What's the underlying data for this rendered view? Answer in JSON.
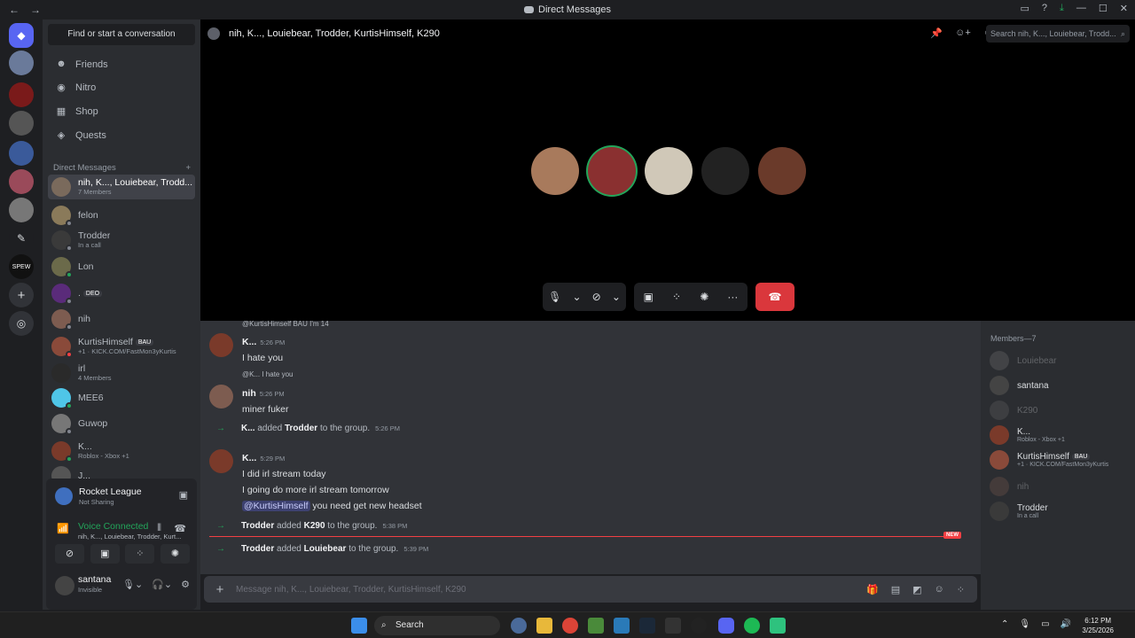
{
  "window": {
    "title": "Direct Messages",
    "back": "←",
    "forward": "→"
  },
  "titlebar_icons": [
    "inbox-icon",
    "help-icon",
    "download-icon",
    "minimize-icon",
    "maximize-icon",
    "close-icon"
  ],
  "sidebar": {
    "search_button": "Find or start a conversation",
    "nav": [
      {
        "label": "Friends",
        "icon": "friends-icon"
      },
      {
        "label": "Nitro",
        "icon": "nitro-icon"
      },
      {
        "label": "Shop",
        "icon": "shop-icon"
      },
      {
        "label": "Quests",
        "icon": "quests-icon"
      }
    ],
    "dm_header": "Direct Messages",
    "dm_add": "+",
    "dms": [
      {
        "name": "nih, K..., Louiebear, Trodd...",
        "sub": "7 Members",
        "color": "#7a6a5c",
        "status": ""
      },
      {
        "name": "felon",
        "sub": "",
        "color": "#8a7a5a",
        "status": "off"
      },
      {
        "name": "Trodder",
        "sub": "In a call",
        "color": "#3a3a3a",
        "status": "off"
      },
      {
        "name": "Lon",
        "sub": "",
        "color": "#6b6a4a",
        "status": "on"
      },
      {
        "name": ".",
        "badge": "DEO",
        "sub": "",
        "color": "#5a2b7a",
        "status": "off"
      },
      {
        "name": "nih",
        "sub": "",
        "color": "#7d5c50",
        "status": "off"
      },
      {
        "name": "KurtisHimself",
        "badge": "BAU",
        "sub": "+1 · KICK.COM/FastMon3yKurtis",
        "color": "#8a4a3a",
        "status": "dnd"
      },
      {
        "name": "irl",
        "sub": "4 Members",
        "color": "#2a2a2a",
        "status": ""
      },
      {
        "name": "MEE6",
        "sub": "",
        "color": "#4fc6e8",
        "status": "on"
      },
      {
        "name": "Guwop",
        "sub": "",
        "color": "#777",
        "status": "off"
      },
      {
        "name": "K...",
        "sub": "Roblox - Xbox +1",
        "color": "#7a3a2a",
        "status": "on"
      },
      {
        "name": "J...",
        "sub": "",
        "color": "#555",
        "status": "off"
      }
    ],
    "activity": {
      "game": "Rocket League",
      "game_sub": "Not Sharing",
      "voice_status": "Voice Connected",
      "voice_channel": "nih, K..., Louiebear, Trodder, Kurt...",
      "user_name": "santana",
      "user_status": "Invisible"
    }
  },
  "call": {
    "channel_title": "nih, K..., Louiebear, Trodder, KurtisHimself, K290",
    "search_placeholder": "Search nih, K..., Louiebear, Trodd...",
    "participants": [
      {
        "name": "participant-1",
        "color": "#a87a5c"
      },
      {
        "name": "participant-2",
        "color": "#8a3030",
        "speaking": true
      },
      {
        "name": "participant-3",
        "color": "#d0c8b8"
      },
      {
        "name": "participant-4",
        "color": "#222"
      },
      {
        "name": "participant-5",
        "color": "#6a3a2a"
      }
    ]
  },
  "chat": {
    "top_reply": "@KurtisHimself  BAU  I'm 14",
    "messages": [
      {
        "author": "K...",
        "time": "5:26 PM",
        "lines": [
          "I hate you"
        ],
        "color": "#7a3a2a"
      },
      {
        "reply": "@K... I hate you",
        "author": "nih",
        "time": "5:26 PM",
        "lines": [
          "miner fuker"
        ],
        "color": "#7d5c50"
      },
      {
        "author": "K...",
        "time": "5:29 PM",
        "lines": [
          "I did irl stream today",
          "I going do more irl stream tomorrow"
        ],
        "mention": "@KurtisHimself",
        "mention_rest": " you need get new headset",
        "color": "#7a3a2a"
      }
    ],
    "system": [
      {
        "actor": "K...",
        "verb": "added",
        "target": "Trodder",
        "rest": "to the group.",
        "time": "5:26 PM"
      },
      {
        "actor": "Trodder",
        "verb": "added",
        "target": "K290",
        "rest": "to the group.",
        "time": "5:38 PM"
      },
      {
        "actor": "Trodder",
        "verb": "added",
        "target": "Louiebear",
        "rest": "to the group.",
        "time": "5:39 PM"
      }
    ],
    "new_tag": "NEW",
    "input_placeholder": "Message nih, K..., Louiebear, Trodder, KurtisHimself, K290"
  },
  "members": {
    "header": "Members—7",
    "list": [
      {
        "name": "Louiebear",
        "sub": "",
        "off": true,
        "color": "#777"
      },
      {
        "name": "santana",
        "sub": "",
        "off": false,
        "color": "#444"
      },
      {
        "name": "K290",
        "sub": "",
        "off": true,
        "color": "#666"
      },
      {
        "name": "K...",
        "sub": "Roblox - Xbox +1",
        "off": false,
        "color": "#7a3a2a"
      },
      {
        "name": "KurtisHimself",
        "badge": "BAU",
        "sub": "+1 · KICK.COM/FastMon3yKurtis",
        "off": false,
        "color": "#8a4a3a"
      },
      {
        "name": "nih",
        "sub": "",
        "off": true,
        "color": "#7d5c50"
      },
      {
        "name": "Trodder",
        "sub": "In a call",
        "off": false,
        "color": "#3a3a3a"
      }
    ]
  },
  "taskbar": {
    "search": "Search",
    "time": "6:12 PM",
    "date": "3/25/2026"
  }
}
